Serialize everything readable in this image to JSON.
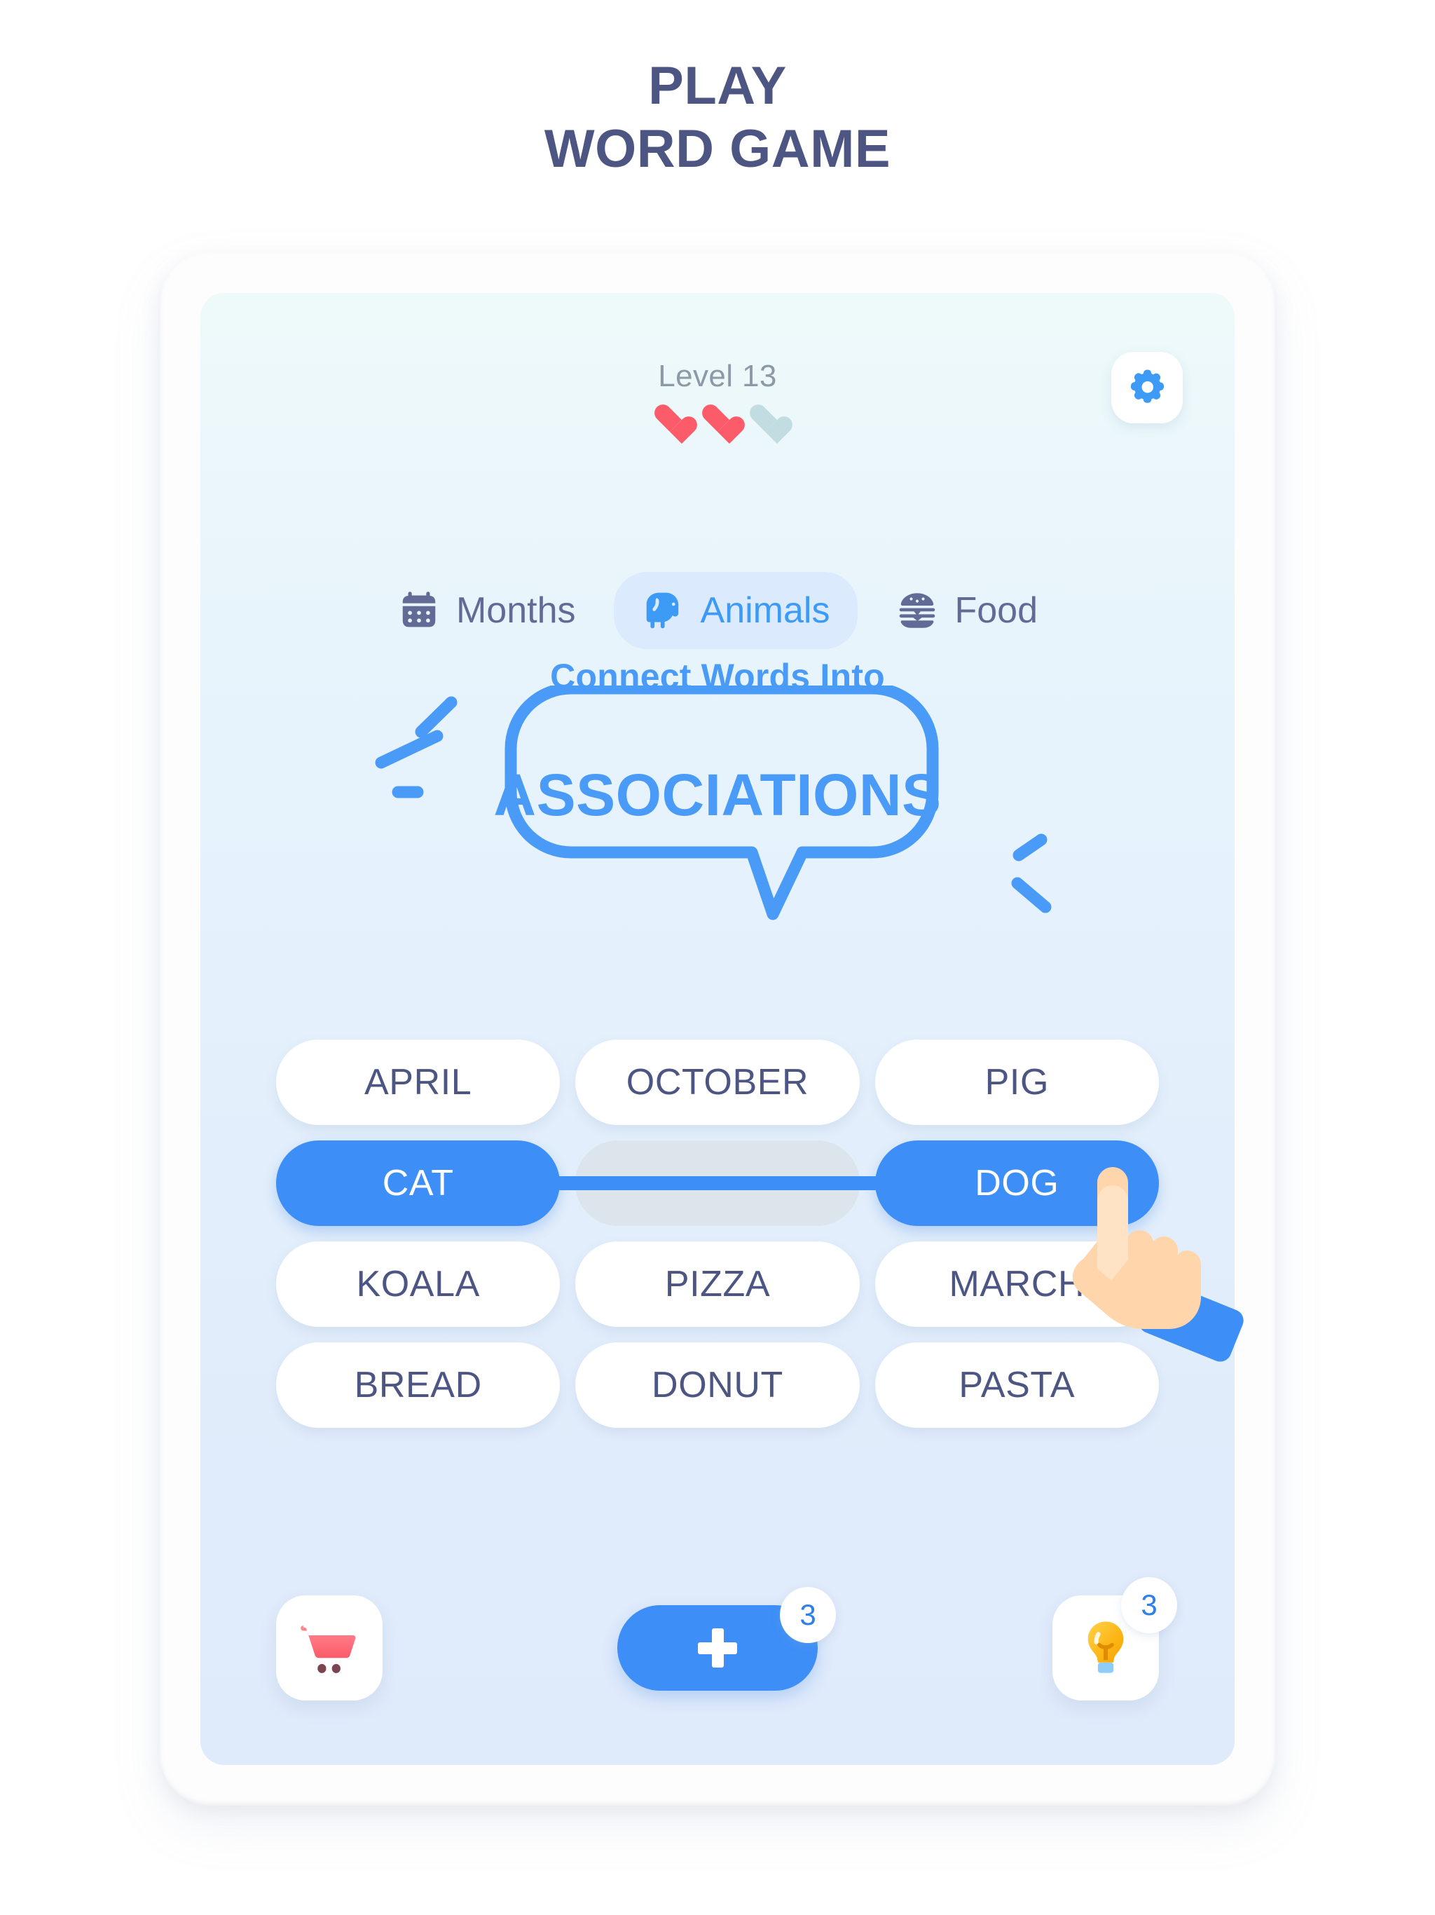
{
  "headline": {
    "line1": "PLAY",
    "line2": "WORD GAME"
  },
  "colors": {
    "accent_blue": "#3d8ef7",
    "bubble_blue": "#4a9bf7",
    "tab_active_bg": "#dbeafd",
    "text_slate": "#4d5583",
    "heart_full": "#fc5b69",
    "heart_empty": "#c2dde2",
    "placeholder_gray": "#dce4ec",
    "badge_text": "#2f7fe8",
    "cart_pink": "#fc6a78",
    "bulb_yellow": "#fdb813"
  },
  "header": {
    "level_label": "Level 13",
    "lives_total": 3,
    "lives_remaining": 2,
    "hearts": [
      "full",
      "full",
      "empty"
    ],
    "settings_icon": "gear-icon"
  },
  "tabs": [
    {
      "label": "Months",
      "icon": "calendar-icon",
      "active": false
    },
    {
      "label": "Animals",
      "icon": "elephant-icon",
      "active": true
    },
    {
      "label": "Food",
      "icon": "burger-icon",
      "active": false
    }
  ],
  "prompt": {
    "subtitle": "Connect Words Into",
    "bubble_text": "ASSOCIATIONS"
  },
  "grid": {
    "rows": [
      [
        {
          "text": "APRIL",
          "state": "default"
        },
        {
          "text": "OCTOBER",
          "state": "default"
        },
        {
          "text": "PIG",
          "state": "default"
        }
      ],
      [
        {
          "text": "CAT",
          "state": "selected"
        },
        {
          "text": "",
          "state": "placeholder"
        },
        {
          "text": "DOG",
          "state": "selected"
        }
      ],
      [
        {
          "text": "KOALA",
          "state": "default"
        },
        {
          "text": "PIZZA",
          "state": "default"
        },
        {
          "text": "MARCH",
          "state": "default"
        }
      ],
      [
        {
          "text": "BREAD",
          "state": "default"
        },
        {
          "text": "DONUT",
          "state": "default"
        },
        {
          "text": "PASTA",
          "state": "default"
        }
      ]
    ],
    "connection": {
      "from": "CAT",
      "to": "DOG"
    },
    "tap_target": "DOG",
    "cursor": "pointing-hand-icon"
  },
  "toolbar": {
    "shop": {
      "icon": "shopping-cart-icon",
      "label": ""
    },
    "add": {
      "icon": "plus-icon",
      "badge": "3"
    },
    "hint": {
      "icon": "lightbulb-icon",
      "badge": "3"
    }
  }
}
